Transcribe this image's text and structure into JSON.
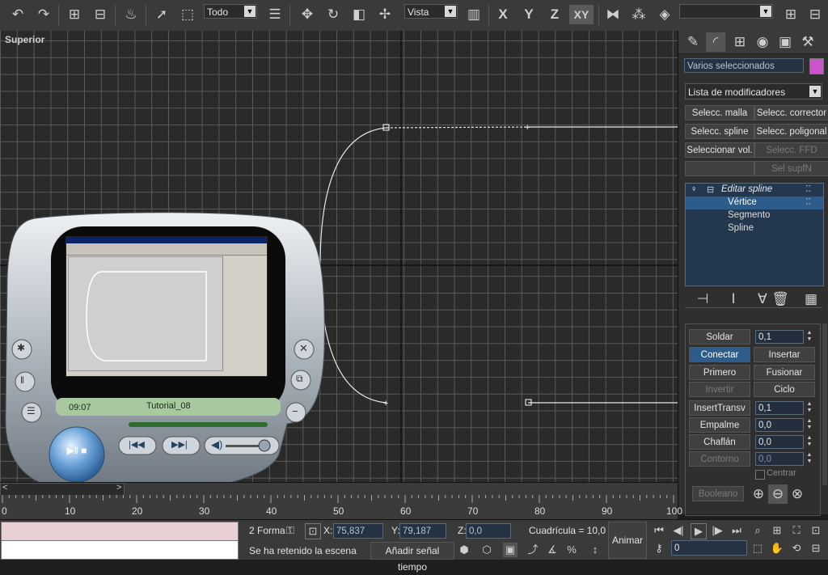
{
  "toolbar": {
    "selection_filter": "Todo",
    "reference_coord": "Vista",
    "axis_x": "X",
    "axis_y": "Y",
    "axis_z": "Z",
    "axis_xy": "XY",
    "named_selection": ""
  },
  "viewport": {
    "label": "Superior"
  },
  "player": {
    "time": "09:07",
    "title": "Tutorial_08"
  },
  "panel": {
    "object_name": "Varios seleccionados",
    "object_color": "#cc55cc",
    "modifier_list": "Lista de modificadores",
    "mod_buttons": [
      "Selecc. malla",
      "Selecc. corrector",
      "Selecc. spline",
      "Selecc. poligonal",
      "Seleccionar vol.",
      "Selecc. FFD",
      "",
      "Sel supfN"
    ],
    "stack": {
      "modifier": "Editar spline",
      "items": [
        "Vértice",
        "Segmento",
        "Spline"
      ]
    },
    "geometry": {
      "soldar": "Soldar",
      "soldar_value": "0,1",
      "conectar": "Conectar",
      "insertar": "Insertar",
      "primero": "Primero",
      "fusionar": "Fusionar",
      "invertir": "Invertir",
      "ciclo": "Ciclo",
      "insert_transv": "InsertTransv",
      "insert_transv_value": "0,1",
      "empalme": "Empalme",
      "empalme_value": "0,0",
      "chaflan": "Chaflán",
      "chaflan_value": "0,0",
      "contorno": "Contorno",
      "contorno_value": "0,0",
      "centrar": "Centrar",
      "booleano": "Booleano"
    }
  },
  "timeline": {
    "ticks": [
      "0",
      "10",
      "20",
      "30",
      "40",
      "50",
      "60",
      "70",
      "80",
      "90",
      "100"
    ]
  },
  "status": {
    "selected": "2 Forma",
    "x_label": "X:",
    "x_value": "75,837",
    "y_label": "Y:",
    "y_value": "79,187",
    "z_label": "Z:",
    "z_value": "0,0",
    "grid": "Cuadrícula = 10,0",
    "prompt": "Se ha retenido la escena",
    "add_key": "Añadir señal tiempo",
    "animate": "Animar",
    "frame": "0"
  }
}
